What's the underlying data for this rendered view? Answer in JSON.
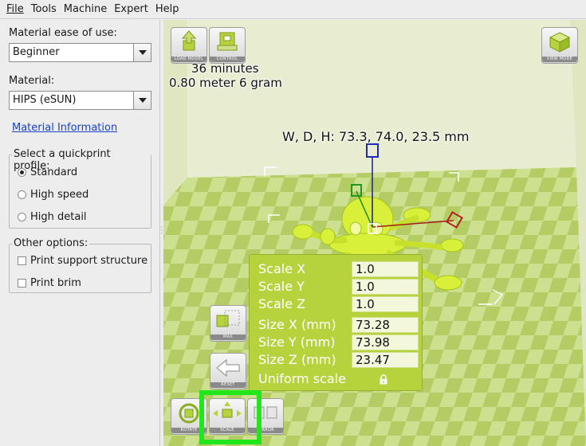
{
  "menu": [
    "File",
    "Tools",
    "Machine",
    "Expert",
    "Help"
  ],
  "left": {
    "ease_label": "Material ease of use:",
    "ease_value": "Beginner",
    "material_label": "Material:",
    "material_value": "HIPS (eSUN)",
    "material_info_link": "Material Information",
    "quickprint_title": "Select a quickprint profile:",
    "profiles": [
      {
        "label": "Standard",
        "selected": true
      },
      {
        "label": "High speed",
        "selected": false
      },
      {
        "label": "High detail",
        "selected": false
      }
    ],
    "other_title": "Other options:",
    "options": [
      {
        "label": "Print support structure",
        "checked": false
      },
      {
        "label": "Print brim",
        "checked": false
      }
    ]
  },
  "viewport": {
    "top_buttons": [
      "LOAD MODEL",
      "CONTROL"
    ],
    "view_mode_button": "VIEW MODE",
    "print_time": "36 minutes",
    "print_material": "0.80 meter 6 gram",
    "dimensions": "W, D, H: 73.3, 74.0, 23.5 mm",
    "side_buttons": [
      "MAX",
      "RESET"
    ],
    "bottom_buttons": [
      "ROTATE",
      "SCALE",
      "MIRROR"
    ],
    "scale_panel": {
      "scale_x_label": "Scale X",
      "scale_x": "1.0",
      "scale_y_label": "Scale Y",
      "scale_y": "1.0",
      "scale_z_label": "Scale Z",
      "scale_z": "1.0",
      "size_x_label": "Size X (mm)",
      "size_x": "73.28",
      "size_y_label": "Size Y (mm)",
      "size_y": "73.98",
      "size_z_label": "Size Z (mm)",
      "size_z": "23.47",
      "uniform_label": "Uniform scale"
    }
  },
  "colors": {
    "accent_green": "#b6d23c",
    "model_yellow": "#d9f03a",
    "highlight": "#22e61c"
  }
}
